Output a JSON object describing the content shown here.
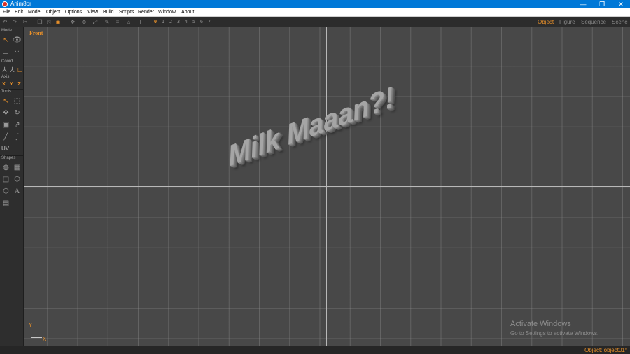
{
  "window": {
    "title": "Anim8or",
    "controls": {
      "minimize": "—",
      "maximize": "❐",
      "close": "✕"
    }
  },
  "menu": [
    "File",
    "Edit",
    "Mode",
    "Object",
    "Options",
    "View",
    "Build",
    "Scripts",
    "Render",
    "Window",
    "About"
  ],
  "toolbar": {
    "frames": [
      "0",
      "1",
      "2",
      "3",
      "4",
      "5",
      "6",
      "7"
    ],
    "active_frame": "0",
    "modes": [
      "Object",
      "Figure",
      "Sequence",
      "Scene"
    ],
    "active_mode": "Object"
  },
  "left_panel": {
    "sections": {
      "mode": "Mode",
      "coord": "Coord",
      "axis": "Axis",
      "tools": "Tools",
      "shapes": "Shapes"
    },
    "axis_buttons": [
      "X",
      "Y",
      "Z"
    ],
    "uv_label": "UV"
  },
  "viewport": {
    "label": "Front",
    "text_object": "Milk Maaan?!",
    "gizmo": {
      "y": "Y",
      "x": "X"
    }
  },
  "watermark": {
    "line1": "Activate Windows",
    "line2": "Go to Settings to activate Windows."
  },
  "status": {
    "text": "Object: object01*"
  },
  "colors": {
    "accent": "#e8902a",
    "titlebar": "#0078d7",
    "viewport": "#484848"
  }
}
